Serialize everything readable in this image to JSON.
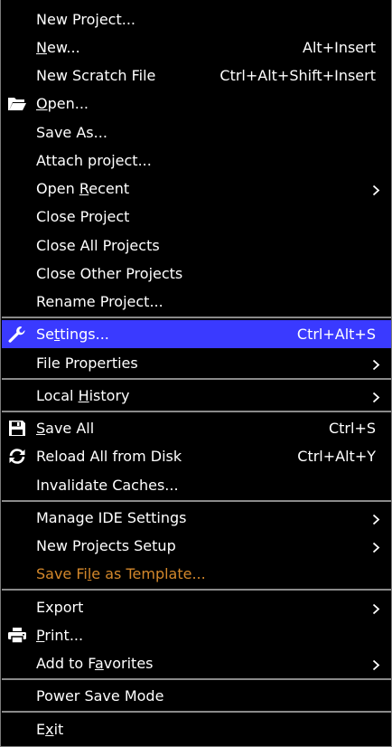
{
  "menu": {
    "items": [
      {
        "label": "New Project...",
        "shortcut": "",
        "submenu": false
      },
      {
        "label": "New...",
        "mnemonic": "N",
        "shortcut": "Alt+Insert",
        "submenu": false
      },
      {
        "label": "New Scratch File",
        "shortcut": "Ctrl+Alt+Shift+Insert",
        "submenu": false
      },
      {
        "label": "Open...",
        "mnemonic": "O",
        "icon": "open-folder-icon",
        "shortcut": "",
        "submenu": false
      },
      {
        "label": "Save As...",
        "shortcut": "",
        "submenu": false
      },
      {
        "label": "Attach project...",
        "shortcut": "",
        "submenu": false
      },
      {
        "label": "Open Recent",
        "mnemonic": "R",
        "shortcut": "",
        "submenu": true
      },
      {
        "label": "Close Project",
        "mnemonic": "j",
        "shortcut": "",
        "submenu": false
      },
      {
        "label": "Close All Projects",
        "shortcut": "",
        "submenu": false
      },
      {
        "label": "Close Other Projects",
        "shortcut": "",
        "submenu": false
      },
      {
        "label": "Rename Project...",
        "shortcut": "",
        "submenu": false
      },
      {
        "label": "Settings...",
        "mnemonic": "t",
        "icon": "wrench-icon",
        "shortcut": "Ctrl+Alt+S",
        "submenu": false,
        "selected": true
      },
      {
        "label": "File Properties",
        "shortcut": "",
        "submenu": true
      },
      {
        "label": "Local History",
        "mnemonic": "H",
        "shortcut": "",
        "submenu": true
      },
      {
        "label": "Save All",
        "mnemonic": "S",
        "icon": "save-icon",
        "shortcut": "Ctrl+S",
        "submenu": false
      },
      {
        "label": "Reload All from Disk",
        "icon": "reload-icon",
        "shortcut": "Ctrl+Alt+Y",
        "submenu": false
      },
      {
        "label": "Invalidate Caches...",
        "shortcut": "",
        "submenu": false
      },
      {
        "label": "Manage IDE Settings",
        "shortcut": "",
        "submenu": true
      },
      {
        "label": "New Projects Setup",
        "shortcut": "",
        "submenu": true
      },
      {
        "label": "Save File as Template...",
        "mnemonic": "l",
        "shortcut": "",
        "submenu": false,
        "disabled": true
      },
      {
        "label": "Export",
        "shortcut": "",
        "submenu": true
      },
      {
        "label": "Print...",
        "mnemonic": "P",
        "icon": "printer-icon",
        "shortcut": "",
        "submenu": false
      },
      {
        "label": "Add to Favorites",
        "mnemonic": "a",
        "shortcut": "",
        "submenu": true
      },
      {
        "label": "Power Save Mode",
        "shortcut": "",
        "submenu": false
      },
      {
        "label": "Exit",
        "mnemonic": "x",
        "shortcut": "",
        "submenu": false
      }
    ]
  },
  "colors": {
    "background": "#000000",
    "text": "#ffffff",
    "selected_background": "#3a3aff",
    "disabled_text": "#d4882b",
    "separator": "#8a8a8a"
  }
}
